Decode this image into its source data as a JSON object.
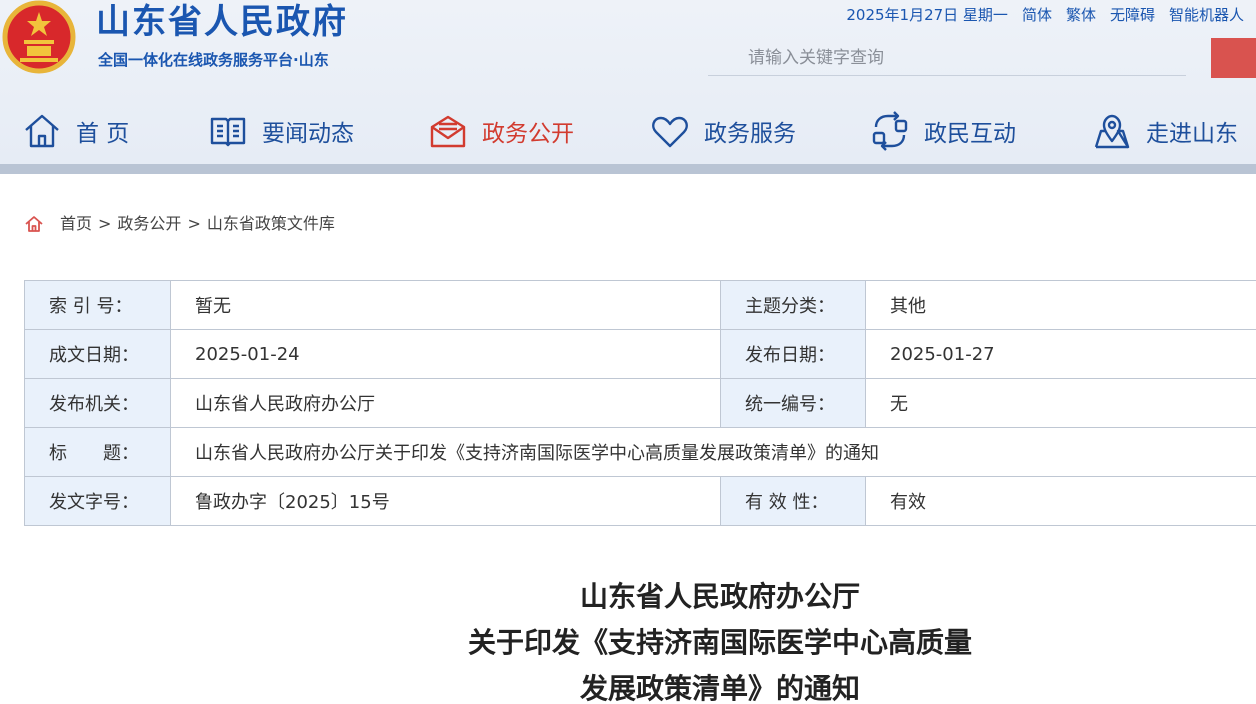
{
  "header": {
    "site_title": "山东省人民政府",
    "site_subtitle": "全国一体化在线政务服务平台·山东",
    "date": "2025年1月27日 星期一",
    "links": [
      "简体",
      "繁体",
      "无障碍",
      "智能机器人"
    ],
    "search_placeholder": "请输入关键字查询"
  },
  "nav": {
    "items": [
      {
        "label": "首 页",
        "icon": "home-icon"
      },
      {
        "label": "要闻动态",
        "icon": "book-icon"
      },
      {
        "label": "政务公开",
        "icon": "mail-icon"
      },
      {
        "label": "政务服务",
        "icon": "heart-icon"
      },
      {
        "label": "政民互动",
        "icon": "interact-icon"
      },
      {
        "label": "走进山东",
        "icon": "map-pin-icon"
      }
    ],
    "active_index": 2
  },
  "breadcrumb": {
    "items": [
      "首页",
      "政务公开",
      "山东省政策文件库"
    ],
    "separator": ">"
  },
  "info": {
    "rows": [
      {
        "l1": "索 引 号：",
        "v1": "暂无",
        "l2": "主题分类：",
        "v2": "其他"
      },
      {
        "l1": "成文日期：",
        "v1": "2025-01-24",
        "l2": "发布日期：",
        "v2": "2025-01-27"
      },
      {
        "l1": "发布机关：",
        "v1": "山东省人民政府办公厅",
        "l2": "统一编号：",
        "v2": "无"
      },
      {
        "l1": "标　　题：",
        "v1": "山东省人民政府办公厅关于印发《支持济南国际医学中心高质量发展政策清单》的通知"
      },
      {
        "l1": "发文字号：",
        "v1": "鲁政办字〔2025〕15号",
        "l2": "有 效 性：",
        "v2": "有效"
      }
    ]
  },
  "document": {
    "title_lines": [
      "山东省人民政府办公厅",
      "关于印发《支持济南国际医学中心高质量",
      "发展政策清单》的通知"
    ]
  },
  "colors": {
    "brand_blue": "#1a56b0",
    "accent_red": "#d23b2f",
    "label_bg": "#e9f1fb"
  }
}
